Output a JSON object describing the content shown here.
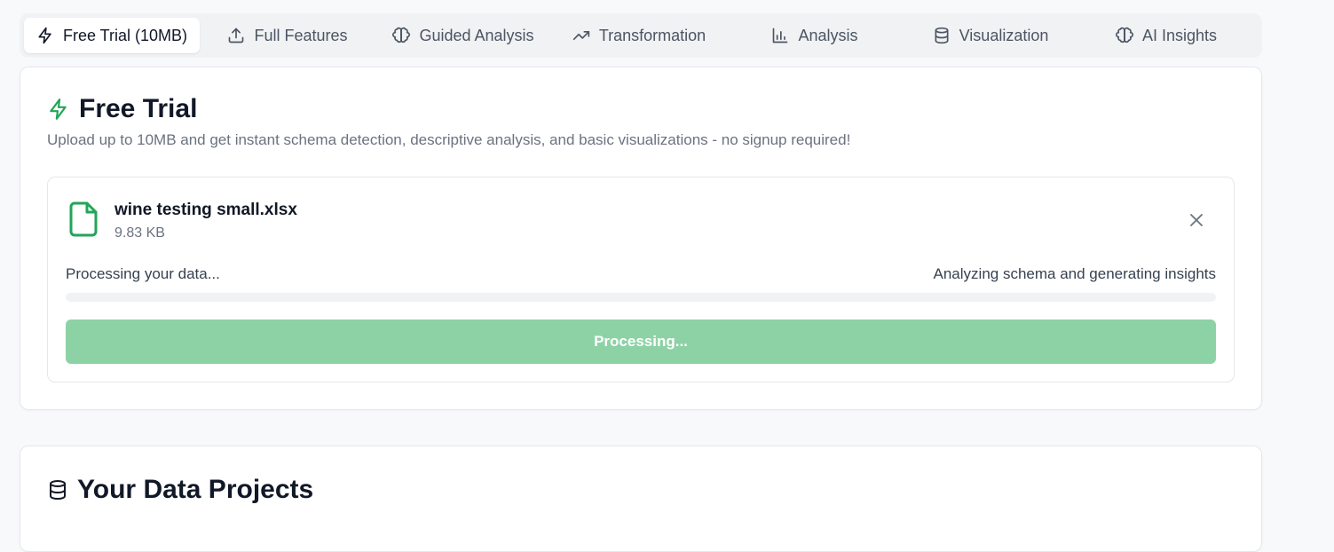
{
  "tabs": [
    {
      "label": "Free Trial (10MB)",
      "icon": "lightning-icon",
      "active": true
    },
    {
      "label": "Full Features",
      "icon": "upload-icon",
      "active": false
    },
    {
      "label": "Guided Analysis",
      "icon": "brain-icon",
      "active": false
    },
    {
      "label": "Transformation",
      "icon": "trending-up-icon",
      "active": false
    },
    {
      "label": "Analysis",
      "icon": "bar-chart-icon",
      "active": false
    },
    {
      "label": "Visualization",
      "icon": "database-icon",
      "active": false
    },
    {
      "label": "AI Insights",
      "icon": "brain-icon",
      "active": false
    }
  ],
  "free_trial": {
    "title": "Free Trial",
    "description": "Upload up to 10MB and get instant schema detection, descriptive analysis, and basic visualizations - no signup required!",
    "file": {
      "name": "wine testing small.xlsx",
      "size": "9.83 KB"
    },
    "status_left": "Processing your data...",
    "status_right": "Analyzing schema and generating insights",
    "progress": 0,
    "button_label": "Processing..."
  },
  "projects": {
    "title": "Your Data Projects"
  },
  "colors": {
    "accent_green": "#22a55a",
    "button_disabled_green": "#8dd2a5"
  }
}
